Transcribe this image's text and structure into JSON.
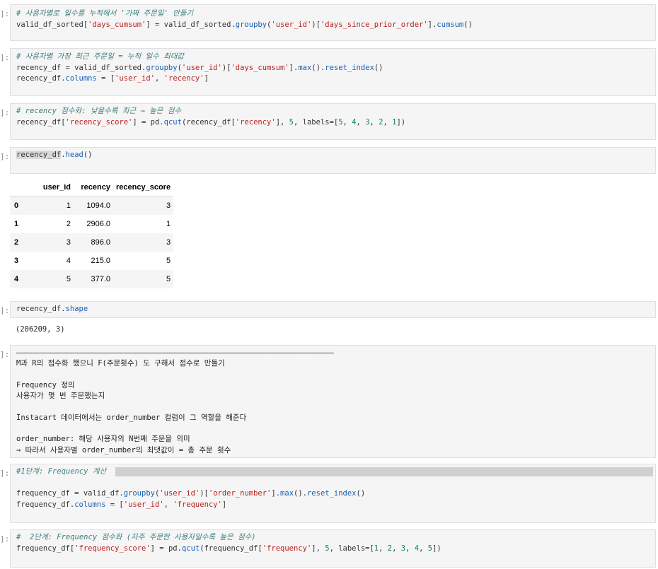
{
  "prompt_symbol": "]:",
  "cells": {
    "c1": {
      "comment": "# 사용자별로 일수를 누적해서 '가짜 주문일' 만들기",
      "line2": [
        "valid_df_sorted[",
        "'days_cumsum'",
        "] = valid_df_sorted.",
        "groupby",
        "(",
        "'user_id'",
        ")[",
        "'days_since_prior_order'",
        "].",
        "cumsum",
        "()"
      ]
    },
    "c2": {
      "comment": "# 사용자별 가장 최근 주문일 = 누적 일수 최대값",
      "line2": [
        "recency_df = valid_df_sorted.",
        "groupby",
        "(",
        "'user_id'",
        ")[",
        "'days_cumsum'",
        "].",
        "max",
        "().",
        "reset_index",
        "()"
      ],
      "line3": [
        "recency_df.",
        "columns",
        " = [",
        "'user_id'",
        ", ",
        "'recency'",
        "]"
      ]
    },
    "c3": {
      "comment": "# recency 점수화: 낮을수록 최근 → 높은 점수",
      "line2": [
        "recency_df[",
        "'recency_score'",
        "] = pd.",
        "qcut",
        "(recency_df[",
        "'recency'",
        "], ",
        "5",
        ", labels=[",
        "5",
        ", ",
        "4",
        ", ",
        "3",
        ", ",
        "2",
        ", ",
        "1",
        "])"
      ]
    },
    "c4": {
      "code_var": "recency_df",
      "code_rest": [
        ".",
        "head",
        "()"
      ]
    },
    "table": {
      "columns": [
        "",
        "user_id",
        "recency",
        "recency_score"
      ],
      "rows": [
        [
          "0",
          "1",
          "1094.0",
          "3"
        ],
        [
          "1",
          "2",
          "2906.0",
          "1"
        ],
        [
          "2",
          "3",
          "896.0",
          "3"
        ],
        [
          "3",
          "4",
          "215.0",
          "5"
        ],
        [
          "4",
          "5",
          "377.0",
          "5"
        ]
      ]
    },
    "c5": {
      "code": [
        "recency_df.",
        "shape"
      ],
      "output": "(206209, 3)"
    },
    "c6": {
      "lines": [
        "———————————————————————————————————————————————————————————————————————",
        "M과 R의 점수화 했으니 F(주문횟수) 도 구해서 점수로 만들기",
        "",
        "Frequency 정의",
        "사용자가 몇 번 주문했는지",
        "",
        "Instacart 데이터에서는 order_number 컬럼이 그 역할을 해준다",
        "",
        "order_number: 해당 사용자의 N번째 주문을 의미",
        "→ 따라서 사용자별 order_number의 최댓값이 = 총 주문 횟수"
      ]
    },
    "c7": {
      "comment": "#1단계: Frequency 계산",
      "line3": [
        "frequency_df = valid_df.",
        "groupby",
        "(",
        "'user_id'",
        ")[",
        "'order_number'",
        "].",
        "max",
        "().",
        "reset_index",
        "()"
      ],
      "line4": [
        "frequency_df.",
        "columns",
        " = [",
        "'user_id'",
        ", ",
        "'frequency'",
        "]"
      ]
    },
    "c8": {
      "comment": "#  2단계: Frequency 점수화 (자주 주문한 사용자일수록 높은 점수)",
      "line2": [
        "frequency_df[",
        "'frequency_score'",
        "] = pd.",
        "qcut",
        "(frequency_df[",
        "'frequency'",
        "], ",
        "5",
        ", labels=[",
        "1",
        ", ",
        "2",
        ", ",
        "3",
        ", ",
        "4",
        ", ",
        "5",
        "])"
      ]
    }
  }
}
